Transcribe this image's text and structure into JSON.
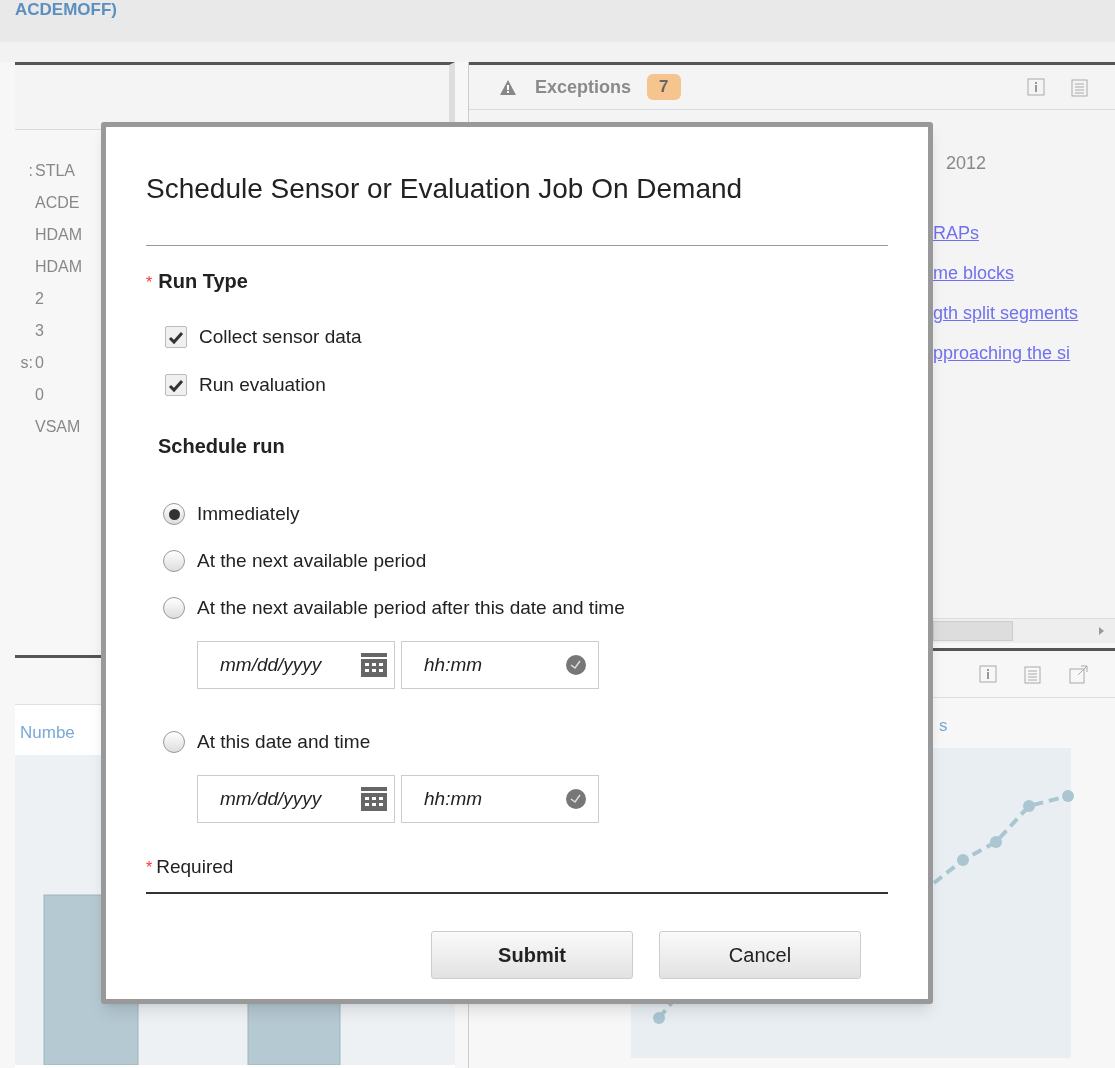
{
  "header": {
    "title": "ACDEMOFF)"
  },
  "summary_panel": {
    "rows": [
      {
        "label": ":",
        "value": "STLA"
      },
      {
        "label": "",
        "value": "ACDE"
      },
      {
        "label": "",
        "value": "HDAM"
      },
      {
        "label": "",
        "value": "HDAM"
      },
      {
        "label": "",
        "value": "2"
      },
      {
        "label": "",
        "value": "3"
      },
      {
        "label": "s:",
        "value": "0"
      },
      {
        "label": "",
        "value": "0"
      },
      {
        "label": "",
        "value": "VSAM"
      }
    ]
  },
  "exceptions_panel": {
    "title": "Exceptions",
    "count": "7",
    "date": "2012",
    "links": [
      "RAPs",
      "me blocks",
      "gth split segments",
      "pproaching the si"
    ]
  },
  "chart_panels": [
    {
      "title": "Numbe"
    },
    {
      "title": "s"
    }
  ],
  "dialog": {
    "title": "Schedule Sensor or Evaluation Job On Demand",
    "run_type": {
      "label": "Run Type",
      "required_mark": "*",
      "options": [
        {
          "label": "Collect sensor data",
          "checked": true
        },
        {
          "label": "Run evaluation",
          "checked": true
        }
      ]
    },
    "schedule": {
      "label": "Schedule run",
      "options": [
        {
          "label": "Immediately",
          "selected": true
        },
        {
          "label": "At the next available period",
          "selected": false
        },
        {
          "label": "At the next available period after this date and time",
          "selected": false,
          "date_placeholder": "mm/dd/yyyy",
          "time_placeholder": "hh:mm"
        },
        {
          "label": "At this date and time",
          "selected": false,
          "date_placeholder": "mm/dd/yyyy",
          "time_placeholder": "hh:mm"
        }
      ]
    },
    "required_note": {
      "mark": "*",
      "text": "Required"
    },
    "buttons": [
      {
        "label": "Submit",
        "primary": true
      },
      {
        "label": "Cancel",
        "primary": false
      }
    ]
  }
}
